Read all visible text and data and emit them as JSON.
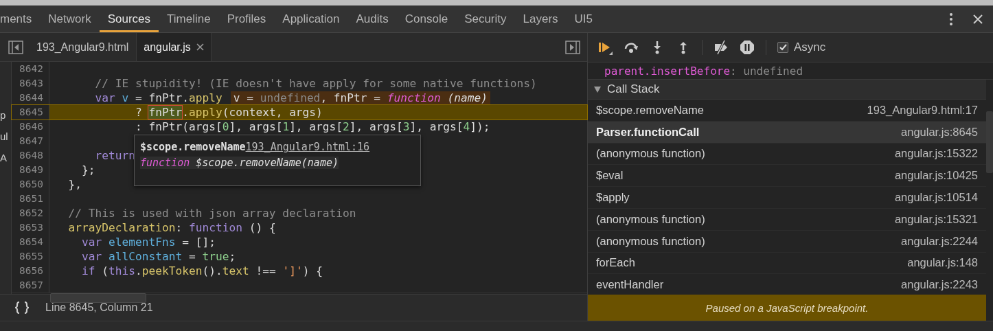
{
  "panel_tabs": [
    {
      "label": "ments",
      "selected": false
    },
    {
      "label": "Network",
      "selected": false
    },
    {
      "label": "Sources",
      "selected": true
    },
    {
      "label": "Timeline",
      "selected": false
    },
    {
      "label": "Profiles",
      "selected": false
    },
    {
      "label": "Application",
      "selected": false
    },
    {
      "label": "Audits",
      "selected": false
    },
    {
      "label": "Console",
      "selected": false
    },
    {
      "label": "Security",
      "selected": false
    },
    {
      "label": "Layers",
      "selected": false
    },
    {
      "label": "UI5",
      "selected": false
    }
  ],
  "sidebar_fragments": [
    "p",
    "ul",
    "A"
  ],
  "file_tabs": [
    {
      "label": "193_Angular9.html",
      "selected": false,
      "closable": false
    },
    {
      "label": "angular.js",
      "selected": true,
      "closable": true
    }
  ],
  "code_lines": [
    {
      "number": "8642",
      "current": false
    },
    {
      "number": "8643",
      "current": false,
      "tokens": [
        {
          "kind": "comment",
          "text": "      // IE stupidity! (IE doesn't have apply for some native functions)"
        }
      ]
    },
    {
      "number": "8644",
      "current": false,
      "tokens": [
        {
          "kind": "keyword",
          "text": "      var"
        },
        {
          "kind": "var",
          "text": " v"
        },
        {
          "kind": "plain",
          "text": " = fnPtr."
        },
        {
          "kind": "prop",
          "text": "apply"
        }
      ],
      "inline_value": [
        {
          "kind": "plain",
          "text": "v = "
        },
        {
          "kind": "muted",
          "text": "undefined"
        },
        {
          "kind": "plain",
          "text": ", fnPtr = "
        },
        {
          "kind": "fn",
          "text": "function"
        },
        {
          "kind": "italic",
          "text": " (name)"
        }
      ]
    },
    {
      "number": "8645",
      "current": true,
      "tokens": [
        {
          "kind": "plain",
          "text": "            ? "
        },
        {
          "kind": "hover",
          "text": "fnPtr"
        },
        {
          "kind": "plain",
          "text": "."
        },
        {
          "kind": "prop",
          "text": "apply"
        },
        {
          "kind": "plain",
          "text": "(context, args)"
        }
      ]
    },
    {
      "number": "8646",
      "current": false,
      "tokens": [
        {
          "kind": "plain",
          "text": "            : fnPtr(args["
        },
        {
          "kind": "number",
          "text": "0"
        },
        {
          "kind": "plain",
          "text": "], args["
        },
        {
          "kind": "number",
          "text": "1"
        },
        {
          "kind": "plain",
          "text": "], args["
        },
        {
          "kind": "number",
          "text": "2"
        },
        {
          "kind": "plain",
          "text": "], args["
        },
        {
          "kind": "number",
          "text": "3"
        },
        {
          "kind": "plain",
          "text": "], args["
        },
        {
          "kind": "number",
          "text": "4"
        },
        {
          "kind": "plain",
          "text": "]);"
        }
      ]
    },
    {
      "number": "8647",
      "current": false
    },
    {
      "number": "8648",
      "current": false,
      "tokens": [
        {
          "kind": "keyword",
          "text": "      return"
        }
      ]
    },
    {
      "number": "8649",
      "current": false,
      "tokens": [
        {
          "kind": "plain",
          "text": "    };"
        }
      ]
    },
    {
      "number": "8650",
      "current": false,
      "tokens": [
        {
          "kind": "plain",
          "text": "  },"
        }
      ]
    },
    {
      "number": "8651",
      "current": false
    },
    {
      "number": "8652",
      "current": false,
      "tokens": [
        {
          "kind": "comment",
          "text": "  // This is used with json array declaration"
        }
      ]
    },
    {
      "number": "8653",
      "current": false,
      "tokens": [
        {
          "kind": "prop",
          "text": "  arrayDeclaration"
        },
        {
          "kind": "plain",
          "text": ": "
        },
        {
          "kind": "keyword",
          "text": "function"
        },
        {
          "kind": "plain",
          "text": " () {"
        }
      ]
    },
    {
      "number": "8654",
      "current": false,
      "tokens": [
        {
          "kind": "keyword",
          "text": "    var"
        },
        {
          "kind": "var",
          "text": " elementFns"
        },
        {
          "kind": "plain",
          "text": " = [];"
        }
      ]
    },
    {
      "number": "8655",
      "current": false,
      "tokens": [
        {
          "kind": "keyword",
          "text": "    var"
        },
        {
          "kind": "var",
          "text": " allConstant"
        },
        {
          "kind": "plain",
          "text": " = "
        },
        {
          "kind": "atom",
          "text": "true"
        },
        {
          "kind": "plain",
          "text": ";"
        }
      ]
    },
    {
      "number": "8656",
      "current": false,
      "tokens": [
        {
          "kind": "keyword",
          "text": "    if"
        },
        {
          "kind": "plain",
          "text": " ("
        },
        {
          "kind": "keyword",
          "text": "this"
        },
        {
          "kind": "plain",
          "text": "."
        },
        {
          "kind": "prop",
          "text": "peekToken"
        },
        {
          "kind": "plain",
          "text": "()."
        },
        {
          "kind": "prop",
          "text": "text"
        },
        {
          "kind": "plain",
          "text": " !== "
        },
        {
          "kind": "string",
          "text": "']'"
        },
        {
          "kind": "plain",
          "text": ") {"
        }
      ]
    },
    {
      "number": "8657",
      "current": false
    }
  ],
  "tooltip": {
    "title": "$scope.removeName",
    "link": "193_Angular9.html:16",
    "signature_keyword": "function",
    "signature": "$scope.removeName(name)"
  },
  "status_bar": {
    "position": "Line 8645, Column 21"
  },
  "debugger_toolbar": {
    "async": {
      "label": "Async",
      "checked": true
    }
  },
  "scope_line": {
    "name": "parent.insertBefore",
    "separator": ":",
    "value": "undefined"
  },
  "call_stack": {
    "title": "Call Stack",
    "expanded": true,
    "frames": [
      {
        "name": "$scope.removeName",
        "location": "193_Angular9.html:17",
        "selected": false
      },
      {
        "name": "Parser.functionCall",
        "location": "angular.js:8645",
        "selected": true
      },
      {
        "name": "(anonymous function)",
        "location": "angular.js:15322",
        "selected": false
      },
      {
        "name": "$eval",
        "location": "angular.js:10425",
        "selected": false
      },
      {
        "name": "$apply",
        "location": "angular.js:10514",
        "selected": false
      },
      {
        "name": "(anonymous function)",
        "location": "angular.js:15321",
        "selected": false
      },
      {
        "name": "(anonymous function)",
        "location": "angular.js:2244",
        "selected": false
      },
      {
        "name": "forEach",
        "location": "angular.js:148",
        "selected": false
      },
      {
        "name": "eventHandler",
        "location": "angular.js:2243",
        "selected": false
      }
    ]
  },
  "paused_message": "Paused on a JavaScript breakpoint."
}
